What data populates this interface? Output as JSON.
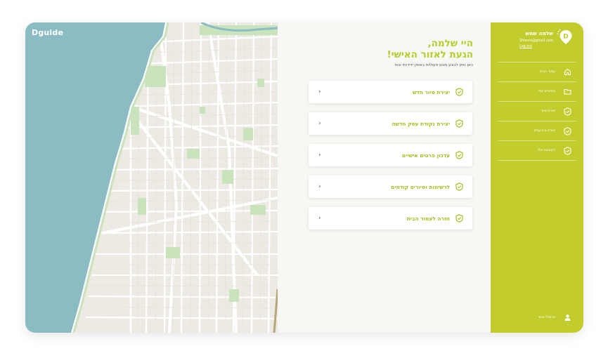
{
  "brand": {
    "name": "Dguide"
  },
  "user": {
    "name": "שלמה שמש",
    "email": "Shlomo@gmail.com",
    "logout": "Log out"
  },
  "greeting": {
    "title_line1": "היי שלמה,",
    "title_line2": "הגעת לאזור האישי!",
    "subtitle": "כאן ניתן לבצע מגוון פעולות באופן ידידותי ונוח"
  },
  "menu": [
    {
      "label": "יצירת סיור חדש",
      "icon": "badge-icon"
    },
    {
      "label": "יצירת נקודת עסק חדשה",
      "icon": "badge-icon"
    },
    {
      "label": "עדכון פרטים אישיים",
      "icon": "badge-icon"
    },
    {
      "label": "לרשימות וסיורים קודמים",
      "icon": "badge-icon"
    },
    {
      "label": "חזרה לעמוד הבית",
      "icon": "badge-icon"
    }
  ],
  "sidebar": {
    "items": [
      {
        "label": "עמוד הבית",
        "icon": "home-icon"
      },
      {
        "label": "הסיורים שלי",
        "icon": "folder-icon"
      },
      {
        "label": "יצירת סיור",
        "icon": "badge-icon"
      },
      {
        "label": "יצירת בית עסק",
        "icon": "badge-icon"
      },
      {
        "label": "הקבוצה שלי",
        "icon": "badge-icon"
      }
    ],
    "profile": {
      "label": "פרופיל אישי",
      "icon": "user-icon"
    }
  },
  "colors": {
    "accent": "#c2cd2d",
    "accent_text": "#a9bd1f",
    "sea": "#8bbcc4",
    "map_land": "#eceae3",
    "park": "#c9e3bd"
  }
}
